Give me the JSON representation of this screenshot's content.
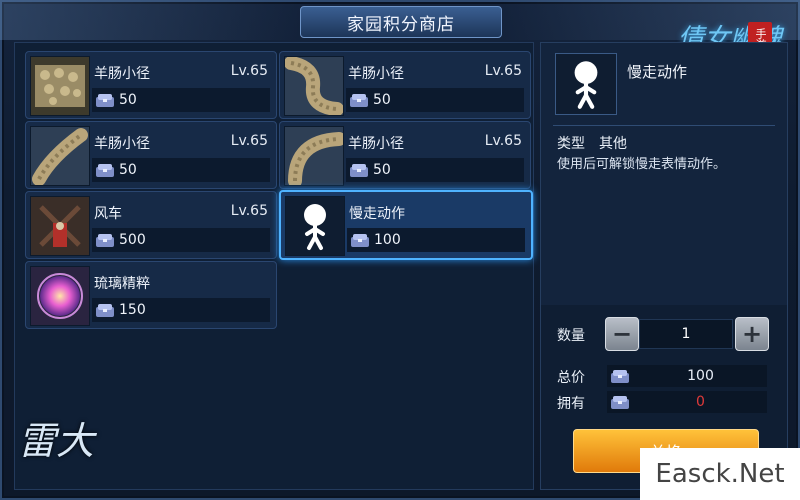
{
  "window": {
    "title": "家园积分商店"
  },
  "logos": {
    "game_logo": "倩女幽魂",
    "game_tag": "手游",
    "left_logo": "雷大"
  },
  "items": [
    {
      "name": "羊肠小径",
      "level": "Lv.65",
      "price": "50",
      "icon": "path-straight-icon"
    },
    {
      "name": "羊肠小径",
      "level": "Lv.65",
      "price": "50",
      "icon": "path-curve-icon"
    },
    {
      "name": "羊肠小径",
      "level": "Lv.65",
      "price": "50",
      "icon": "path-diagonal-icon"
    },
    {
      "name": "羊肠小径",
      "level": "Lv.65",
      "price": "50",
      "icon": "path-bend-icon"
    },
    {
      "name": "风车",
      "level": "Lv.65",
      "price": "500",
      "icon": "windmill-icon"
    },
    {
      "name": "慢走动作",
      "level": "",
      "price": "100",
      "icon": "stickman-icon",
      "selected": true
    },
    {
      "name": "琉璃精粹",
      "level": "",
      "price": "150",
      "icon": "crystal-icon"
    }
  ],
  "detail": {
    "name": "慢走动作",
    "type_label": "类型",
    "type_value": "其他",
    "description": "使用后可解锁慢走表情动作。"
  },
  "purchase": {
    "quantity_label": "数量",
    "quantity": "1",
    "minus": "−",
    "plus": "+",
    "total_label": "总价",
    "total": "100",
    "owned_label": "拥有",
    "owned": "0",
    "exchange_label": "兑换"
  },
  "watermark": "Easck.Net",
  "colors": {
    "accent": "#4fb3ff",
    "owned_zero": "#e03a3a",
    "button": "#f0a020"
  }
}
